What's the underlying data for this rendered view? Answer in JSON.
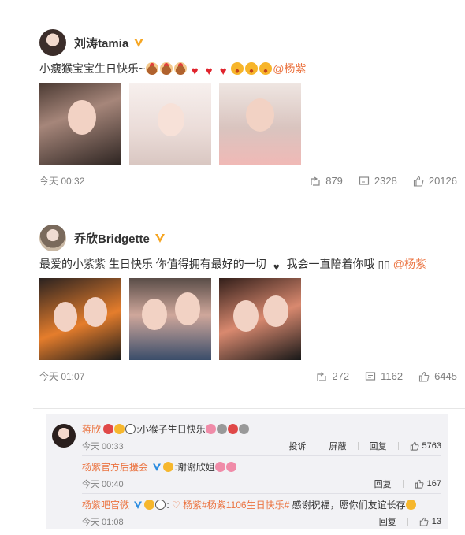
{
  "posts": [
    {
      "author": "刘涛tamia",
      "text": "小瘦猴宝宝生日快乐~",
      "mention": "@杨紫",
      "time": "今天 00:32",
      "reposts": "879",
      "comments": "2328",
      "likes": "20126"
    },
    {
      "author": "乔欣Bridgette",
      "text_a": "最爱的小紫紫 生日快乐 你值得拥有最好的一切",
      "text_b": " 我会一直陪着你哦 ▯▯ ",
      "mention": "@杨紫",
      "time": "今天 01:07",
      "reposts": "272",
      "comments": "1162",
      "likes": "6445"
    }
  ],
  "comment_thread": {
    "main": {
      "name": "蒋欣",
      "text": ":小猴子生日快乐",
      "time": "今天 00:33",
      "repost_label": "投诉",
      "block_label": "屏蔽",
      "reply_label": "回复",
      "likes": "5763"
    },
    "replies": [
      {
        "name": "杨紫官方后援会",
        "text": ":谢谢欣姐",
        "time": "今天 00:40",
        "reply_label": "回复",
        "likes": "167"
      },
      {
        "name": "杨紫吧官微",
        "tag": " 杨紫#杨紫1106生日快乐#",
        "text": " 感谢祝福，愿你们友谊长存",
        "time": "今天 01:08",
        "reply_label": "回复",
        "likes": "13"
      }
    ]
  },
  "colors": {
    "mention": "#eb7340",
    "vip_badge": "#f6a623",
    "muted": "#808080"
  },
  "icons": [
    "repost-icon",
    "comment-icon",
    "like-icon",
    "verified-badge-icon"
  ]
}
